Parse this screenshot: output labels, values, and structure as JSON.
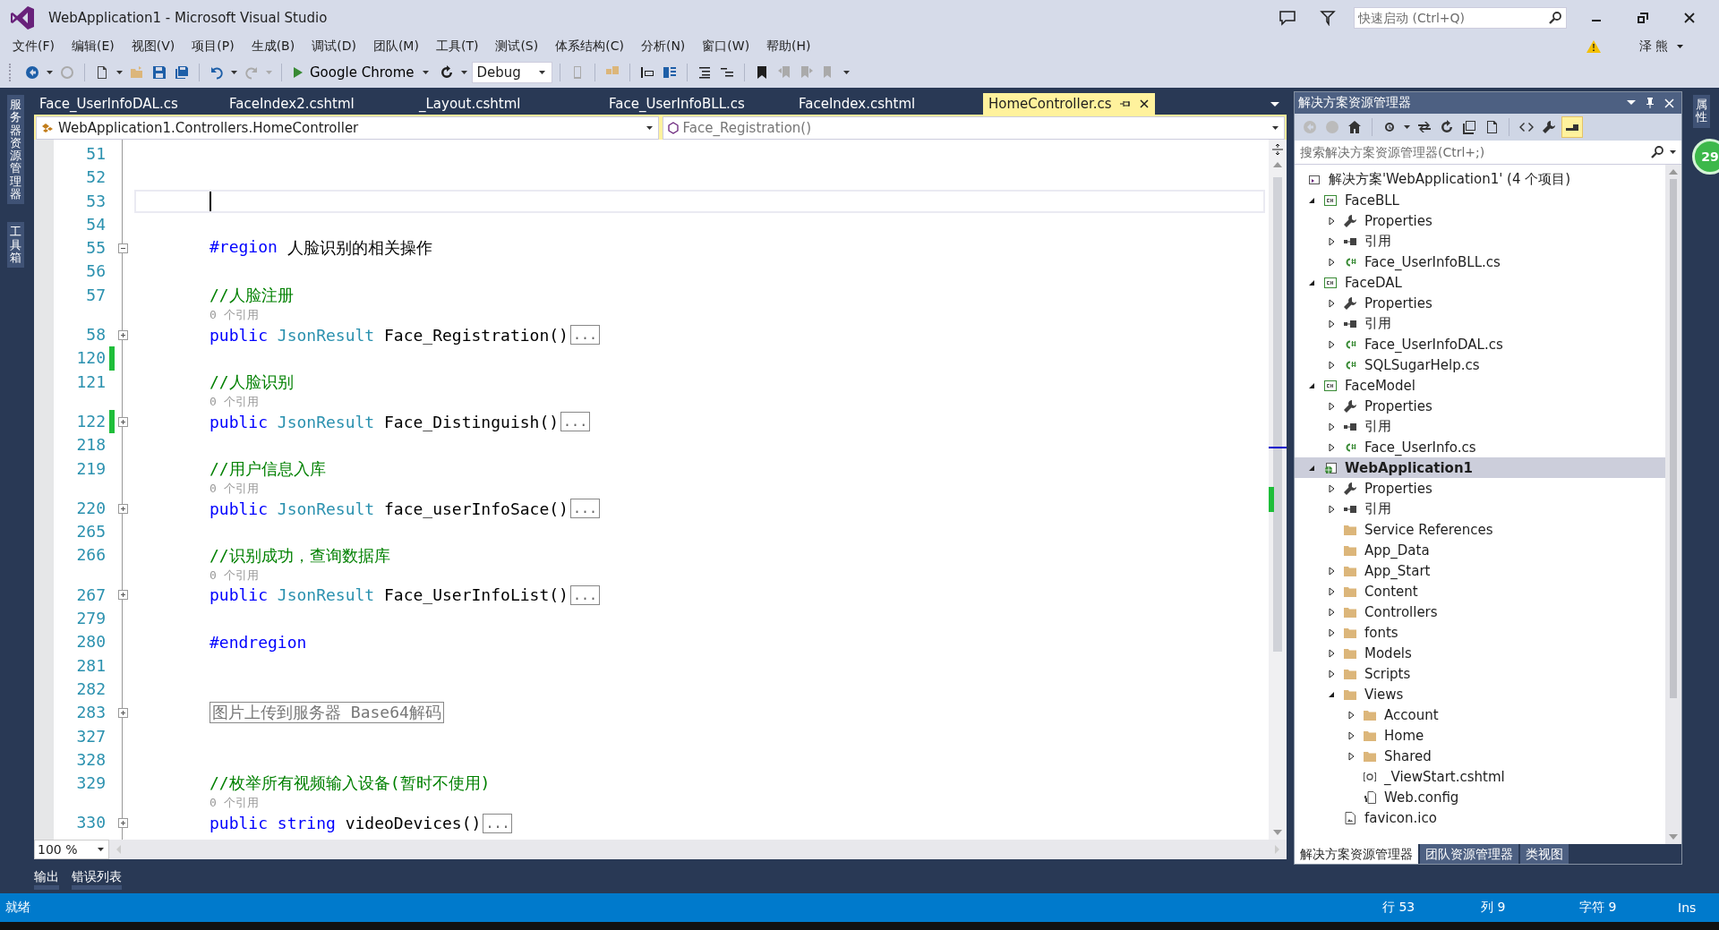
{
  "window": {
    "title": "WebApplication1 - Microsoft Visual Studio"
  },
  "quick_launch": {
    "placeholder": "快速启动 (Ctrl+Q)"
  },
  "user": {
    "name": "泽 熊"
  },
  "menu": [
    "文件(F)",
    "编辑(E)",
    "视图(V)",
    "项目(P)",
    "生成(B)",
    "调试(D)",
    "团队(M)",
    "工具(T)",
    "测试(S)",
    "体系结构(C)",
    "分析(N)",
    "窗口(W)",
    "帮助(H)"
  ],
  "toolbar": {
    "run_target": "Google Chrome",
    "configuration": "Debug"
  },
  "left_dock_tabs": [
    "服务器资源管理器",
    "工具箱"
  ],
  "right_dock_tabs": [
    "属性"
  ],
  "right_badge": "29",
  "doc_tabs": [
    {
      "label": "Face_UserInfoDAL.cs",
      "selected": false
    },
    {
      "label": "FaceIndex2.cshtml",
      "selected": false
    },
    {
      "label": "_Layout.cshtml",
      "selected": false
    },
    {
      "label": "Face_UserInfoBLL.cs",
      "selected": false
    },
    {
      "label": "FaceIndex.cshtml",
      "selected": false
    },
    {
      "label": "HomeController.cs",
      "selected": true
    }
  ],
  "nav_bar": {
    "type": "WebApplication1.Controllers.HomeController",
    "member": "Face_Registration()"
  },
  "editor": {
    "lines": [
      {
        "kind": "code",
        "number": "51"
      },
      {
        "kind": "code",
        "number": "52"
      },
      {
        "kind": "code",
        "number": "53",
        "current": true
      },
      {
        "kind": "code",
        "number": "54"
      },
      {
        "kind": "code",
        "number": "55",
        "folded": false,
        "parts": [
          {
            "kind": "directive",
            "text": "#region"
          },
          {
            "kind": "plain",
            "text": "人脸识别的相关操作"
          }
        ]
      },
      {
        "kind": "code",
        "number": "56"
      },
      {
        "kind": "code",
        "number": "57",
        "parts": [
          {
            "kind": "comment",
            "text": "//人脸注册"
          }
        ]
      },
      {
        "kind": "lens",
        "text": "0 个引用"
      },
      {
        "kind": "code",
        "number": "58",
        "folded": true,
        "parts": [
          {
            "kind": "keyword",
            "text": "public"
          },
          {
            "kind": "type",
            "text": "JsonResult"
          },
          {
            "kind": "plain",
            "text": "Face_Registration()"
          }
        ],
        "ellipsis": "..."
      },
      {
        "kind": "code",
        "number": "120",
        "changed": true
      },
      {
        "kind": "code",
        "number": "121",
        "parts": [
          {
            "kind": "comment",
            "text": "//人脸识别"
          }
        ]
      },
      {
        "kind": "lens",
        "text": "0 个引用"
      },
      {
        "kind": "code",
        "number": "122",
        "changed": true,
        "folded": true,
        "parts": [
          {
            "kind": "keyword",
            "text": "public"
          },
          {
            "kind": "type",
            "text": "JsonResult"
          },
          {
            "kind": "plain",
            "text": "Face_Distinguish()"
          }
        ],
        "ellipsis": "..."
      },
      {
        "kind": "code",
        "number": "218"
      },
      {
        "kind": "code",
        "number": "219",
        "parts": [
          {
            "kind": "comment",
            "text": "//用户信息入库"
          }
        ]
      },
      {
        "kind": "lens",
        "text": "0 个引用"
      },
      {
        "kind": "code",
        "number": "220",
        "folded": true,
        "parts": [
          {
            "kind": "keyword",
            "text": "public"
          },
          {
            "kind": "type",
            "text": "JsonResult"
          },
          {
            "kind": "plain",
            "text": "face_userInfoSace()"
          }
        ],
        "ellipsis": "..."
      },
      {
        "kind": "code",
        "number": "265"
      },
      {
        "kind": "code",
        "number": "266",
        "parts": [
          {
            "kind": "comment",
            "text": "//识别成功，查询数据库"
          }
        ]
      },
      {
        "kind": "lens",
        "text": "0 个引用"
      },
      {
        "kind": "code",
        "number": "267",
        "folded": true,
        "parts": [
          {
            "kind": "keyword",
            "text": "public"
          },
          {
            "kind": "type",
            "text": "JsonResult"
          },
          {
            "kind": "plain",
            "text": "Face_UserInfoList()"
          }
        ],
        "ellipsis": "..."
      },
      {
        "kind": "code",
        "number": "279"
      },
      {
        "kind": "code",
        "number": "280",
        "parts": [
          {
            "kind": "directive",
            "text": "#endregion"
          }
        ]
      },
      {
        "kind": "code",
        "number": "281"
      },
      {
        "kind": "code",
        "number": "282"
      },
      {
        "kind": "code",
        "number": "283",
        "folded": true,
        "outline": "图片上传到服务器 Base64解码"
      },
      {
        "kind": "code",
        "number": "327"
      },
      {
        "kind": "code",
        "number": "328"
      },
      {
        "kind": "code",
        "number": "329",
        "parts": [
          {
            "kind": "comment",
            "text": "//枚举所有视频输入设备(暂时不使用)"
          }
        ]
      },
      {
        "kind": "lens",
        "text": "0 个引用"
      },
      {
        "kind": "code",
        "number": "330",
        "folded": true,
        "parts": [
          {
            "kind": "keyword",
            "text": "public"
          },
          {
            "kind": "keyword",
            "text": "string"
          },
          {
            "kind": "plain",
            "text": "videoDevices()"
          }
        ],
        "ellipsis": "..."
      }
    ],
    "zoom": "100 %"
  },
  "bottom_tabs": [
    "输出",
    "错误列表"
  ],
  "solution_explorer": {
    "title": "解决方案资源管理器",
    "search_placeholder": "搜索解决方案资源管理器(Ctrl+;)",
    "tree": [
      {
        "label": "解决方案'WebApplication1' (4 个项目)",
        "kind": "solution",
        "selected": false,
        "children": [
          {
            "label": "FaceBLL",
            "kind": "project",
            "expanded": true,
            "selected": false,
            "children": [
              {
                "label": "Properties",
                "kind": "properties",
                "expanded": false,
                "selected": false
              },
              {
                "label": "引用",
                "kind": "references",
                "expanded": false,
                "selected": false
              },
              {
                "label": "Face_UserInfoBLL.cs",
                "kind": "csfile",
                "expanded": false,
                "selected": false
              }
            ]
          },
          {
            "label": "FaceDAL",
            "kind": "project",
            "expanded": true,
            "selected": false,
            "children": [
              {
                "label": "Properties",
                "kind": "properties",
                "expanded": false,
                "selected": false
              },
              {
                "label": "引用",
                "kind": "references",
                "expanded": false,
                "selected": false
              },
              {
                "label": "Face_UserInfoDAL.cs",
                "kind": "csfile",
                "expanded": false,
                "selected": false
              },
              {
                "label": "SQLSugarHelp.cs",
                "kind": "csfile",
                "expanded": false,
                "selected": false
              }
            ]
          },
          {
            "label": "FaceModel",
            "kind": "project",
            "expanded": true,
            "selected": false,
            "children": [
              {
                "label": "Properties",
                "kind": "properties",
                "expanded": false,
                "selected": false
              },
              {
                "label": "引用",
                "kind": "references",
                "expanded": false,
                "selected": false
              },
              {
                "label": "Face_UserInfo.cs",
                "kind": "csfile",
                "expanded": false,
                "selected": false
              }
            ]
          },
          {
            "label": "WebApplication1",
            "kind": "webproject",
            "expanded": true,
            "selected": true,
            "children": [
              {
                "label": "Properties",
                "kind": "properties",
                "expanded": false,
                "selected": false
              },
              {
                "label": "引用",
                "kind": "references",
                "expanded": false,
                "selected": false
              },
              {
                "label": "Service References",
                "kind": "folder",
                "selected": false
              },
              {
                "label": "App_Data",
                "kind": "folder",
                "selected": false
              },
              {
                "label": "App_Start",
                "kind": "folder",
                "expanded": false,
                "selected": false
              },
              {
                "label": "Content",
                "kind": "folder",
                "expanded": false,
                "selected": false
              },
              {
                "label": "Controllers",
                "kind": "folder",
                "expanded": false,
                "selected": false
              },
              {
                "label": "fonts",
                "kind": "folder",
                "expanded": false,
                "selected": false
              },
              {
                "label": "Models",
                "kind": "folder",
                "expanded": false,
                "selected": false
              },
              {
                "label": "Scripts",
                "kind": "folder",
                "expanded": false,
                "selected": false
              },
              {
                "label": "Views",
                "kind": "folder",
                "expanded": true,
                "selected": false,
                "children": [
                  {
                    "label": "Account",
                    "kind": "folder",
                    "expanded": false,
                    "selected": false
                  },
                  {
                    "label": "Home",
                    "kind": "folder",
                    "expanded": false,
                    "selected": false
                  },
                  {
                    "label": "Shared",
                    "kind": "folder",
                    "expanded": false,
                    "selected": false
                  },
                  {
                    "label": "_ViewStart.cshtml",
                    "kind": "cshtml",
                    "selected": false
                  },
                  {
                    "label": "Web.config",
                    "kind": "config",
                    "selected": false
                  }
                ]
              },
              {
                "label": "favicon.ico",
                "kind": "image",
                "selected": false
              }
            ]
          }
        ]
      }
    ],
    "tabs": [
      {
        "label": "解决方案资源管理器",
        "selected": true
      },
      {
        "label": "团队资源管理器",
        "selected": false
      },
      {
        "label": "类视图",
        "selected": false
      }
    ]
  },
  "status_bar": {
    "status": "就绪",
    "line": "行 53",
    "column": "列 9",
    "char": "字符 9",
    "mode": "Ins"
  }
}
